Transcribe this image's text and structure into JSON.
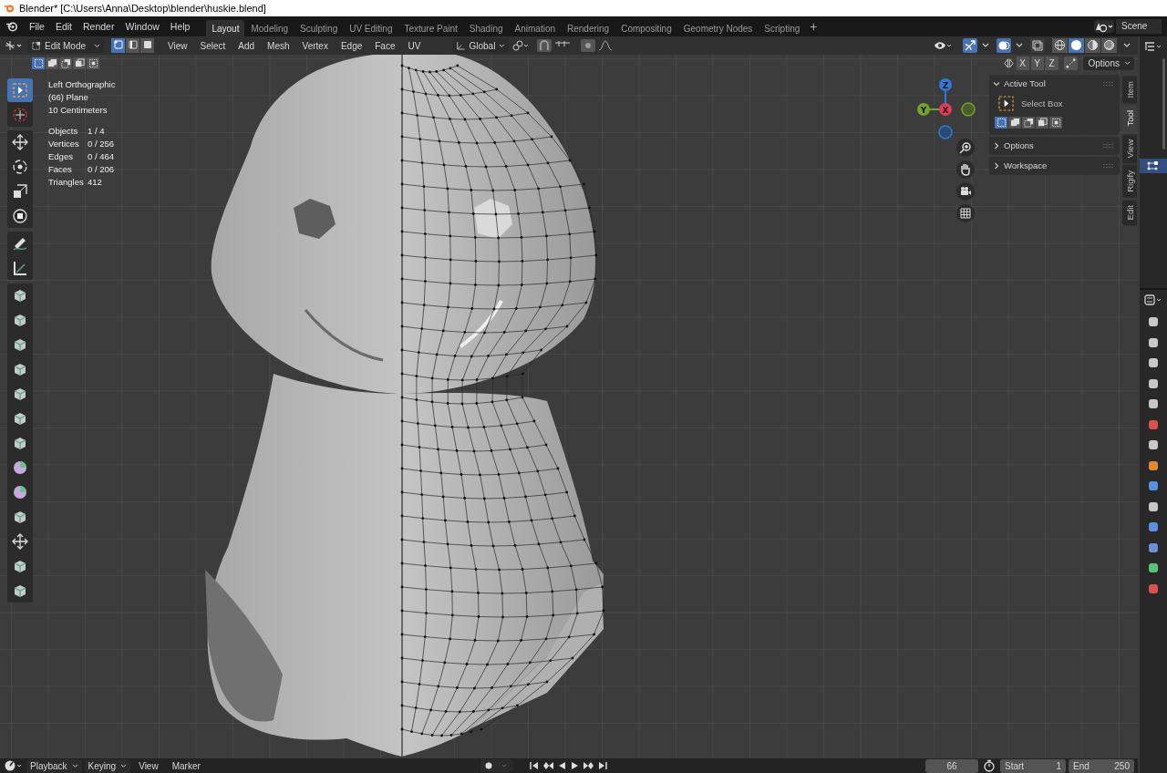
{
  "window": {
    "title": "Blender* [C:\\Users\\Anna\\Desktop\\blender\\huskie.blend]"
  },
  "menu": [
    "File",
    "Edit",
    "Render",
    "Window",
    "Help"
  ],
  "workspaces": [
    {
      "label": "Layout",
      "selected": true
    },
    {
      "label": "Modeling",
      "selected": false
    },
    {
      "label": "Sculpting",
      "selected": false
    },
    {
      "label": "UV Editing",
      "selected": false
    },
    {
      "label": "Texture Paint",
      "selected": false
    },
    {
      "label": "Shading",
      "selected": false
    },
    {
      "label": "Animation",
      "selected": false
    },
    {
      "label": "Rendering",
      "selected": false
    },
    {
      "label": "Compositing",
      "selected": false
    },
    {
      "label": "Geometry Nodes",
      "selected": false
    },
    {
      "label": "Scripting",
      "selected": false
    }
  ],
  "add_workspace": "+",
  "scene": "Scene",
  "header": {
    "mode": "Edit Mode",
    "select_modes": [
      {
        "kind": "vertex",
        "selected": true
      },
      {
        "kind": "edge",
        "selected": false
      },
      {
        "kind": "face",
        "selected": false
      }
    ],
    "menus": [
      "View",
      "Select",
      "Add",
      "Mesh",
      "Vertex",
      "Edge",
      "Face",
      "UV"
    ],
    "orientation": "Global",
    "toggles": [
      {
        "kind": "gizmos",
        "on": true
      },
      {
        "kind": "overlays",
        "on": true
      },
      {
        "kind": "xray",
        "on": false
      }
    ],
    "shading": [
      {
        "kind": "wireframe",
        "selected": false
      },
      {
        "kind": "solid",
        "selected": true
      },
      {
        "kind": "material",
        "selected": false
      },
      {
        "kind": "rendered",
        "selected": false
      }
    ]
  },
  "tool_settings": {
    "modes": [
      {
        "kind": "set",
        "selected": true
      },
      {
        "kind": "extend",
        "selected": false
      },
      {
        "kind": "subtract",
        "selected": false
      },
      {
        "kind": "invert",
        "selected": false
      },
      {
        "kind": "intersect",
        "selected": false
      }
    ],
    "mirror_axes": [
      "X",
      "Y",
      "Z"
    ],
    "options": "Options"
  },
  "tool_groups": [
    [
      {
        "kind": "select",
        "selected": true
      },
      {
        "kind": "cursor",
        "selected": false
      }
    ],
    [
      {
        "kind": "move",
        "selected": false
      },
      {
        "kind": "rotate",
        "selected": false
      },
      {
        "kind": "scale",
        "selected": false
      },
      {
        "kind": "transform",
        "selected": false
      }
    ],
    [
      {
        "kind": "annotate",
        "selected": false
      },
      {
        "kind": "measure",
        "selected": false
      }
    ],
    [
      {
        "kind": "mesh",
        "selected": false
      },
      {
        "kind": "mesh",
        "selected": false
      },
      {
        "kind": "mesh",
        "selected": false
      },
      {
        "kind": "mesh",
        "selected": false
      },
      {
        "kind": "mesh",
        "selected": false
      },
      {
        "kind": "mesh",
        "selected": false
      },
      {
        "kind": "mesh",
        "selected": false
      },
      {
        "kind": "sphere",
        "selected": false
      },
      {
        "kind": "sphere",
        "selected": false
      },
      {
        "kind": "mesh",
        "selected": false
      },
      {
        "kind": "move",
        "selected": false
      },
      {
        "kind": "mesh",
        "selected": false
      },
      {
        "kind": "mesh",
        "selected": false
      }
    ]
  ],
  "viewport": {
    "view": "Left Orthographic",
    "object": "(66) Plane",
    "scale": "10 Centimeters",
    "stats": [
      {
        "label": "Objects",
        "value": "1 / 4"
      },
      {
        "label": "Vertices",
        "value": "0 / 256"
      },
      {
        "label": "Edges",
        "value": "0 / 464"
      },
      {
        "label": "Faces",
        "value": "0 / 206"
      },
      {
        "label": "Triangles",
        "value": "412"
      }
    ]
  },
  "gizmo_axes": [
    {
      "label": "Z",
      "color": "#2f7ad6"
    },
    {
      "label": "Y",
      "color": "#73a12a"
    },
    {
      "label": "X",
      "color": "#e8375a"
    }
  ],
  "sidebar": {
    "panels": [
      {
        "title": "Active Tool",
        "expanded": true
      },
      {
        "title": "Options",
        "expanded": false
      },
      {
        "title": "Workspace",
        "expanded": false
      }
    ],
    "active_tool": {
      "name": "Select Box",
      "modes": [
        {
          "kind": "set",
          "selected": true
        },
        {
          "kind": "extend",
          "selected": false
        },
        {
          "kind": "subtract",
          "selected": false
        },
        {
          "kind": "invert",
          "selected": false
        },
        {
          "kind": "intersect",
          "selected": false
        }
      ]
    },
    "tabs": [
      {
        "label": "Item",
        "selected": false
      },
      {
        "label": "Tool",
        "selected": true
      },
      {
        "label": "View",
        "selected": false
      },
      {
        "label": "Rigify",
        "selected": false
      },
      {
        "label": "Edit",
        "selected": false
      }
    ]
  },
  "timeline": {
    "menus": [
      {
        "label": "Playback",
        "kind": "dropdown"
      },
      {
        "label": "Keying",
        "kind": "dropdown"
      },
      {
        "label": "View",
        "kind": "menu"
      },
      {
        "label": "Marker",
        "kind": "menu"
      }
    ],
    "frame": "66",
    "start_label": "Start",
    "start": "1",
    "end_label": "End",
    "end": "250"
  }
}
